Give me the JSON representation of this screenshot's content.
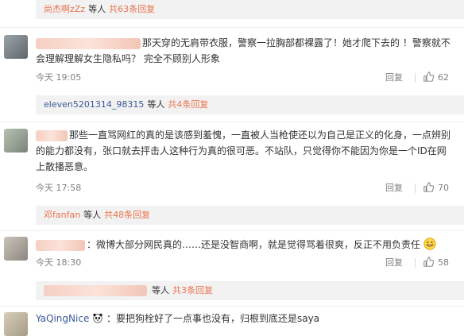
{
  "comments": [
    {
      "top_reply": {
        "user": "尚杰啊zZz",
        "mid": "等人",
        "count": "共63条回复"
      },
      "text": "那天穿的无肩带衣服，警察一拉胸部都裸露了！她才爬下去的 ！警察就不会理解理解女生隐私吗？ 完全不顾别人形象",
      "time": "今天 19:05",
      "reply_label": "回复",
      "likes": "62"
    },
    {
      "top_reply": {
        "user": "eleven5201314_98315",
        "mid": "等人",
        "count": "共4条回复"
      },
      "text": "那些一直骂网红的真的是该感到羞愧，一直被人当枪使还以为自己是正义的化身，一点辨别的能力都没有，张口就去抨击人这种行为真的很可恶。不站队，只觉得你不能因为你是一个ID在网上散播恶意。",
      "time": "今天 17:58",
      "reply_label": "回复",
      "likes": "70"
    },
    {
      "top_reply": {
        "user": "邓fanfan",
        "mid": "等人",
        "count": "共48条回复"
      },
      "text": "：微博大部分网民真的……还是没智商啊，就是觉得骂着很爽，反正不用负责任",
      "time": "今天 18:30",
      "reply_label": "回复",
      "likes": "58"
    },
    {
      "top_reply": {
        "user": "",
        "mid": "等人",
        "count": "共3条回复"
      },
      "text": "：要把狗栓好了一点事也没有，归根到底还是saya",
      "user": "YaQingNice"
    }
  ],
  "icons": {
    "like": "thumbs-up-icon",
    "emoji": "grin-emoji-icon",
    "badge": "panda-icon"
  },
  "colors": {
    "link": "#eb7350",
    "username_blue": "#3b5998",
    "meta": "#808080",
    "reply_bg": "#f2f2f2"
  }
}
